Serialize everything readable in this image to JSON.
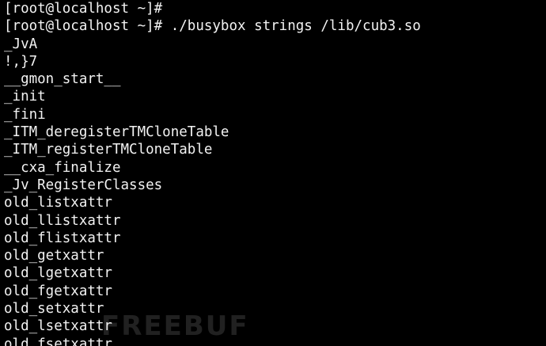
{
  "terminal": {
    "background": "#000000",
    "foreground": "#f2f2f2",
    "lines": [
      "[root@localhost ~]#",
      "[root@localhost ~]# ./busybox strings /lib/cub3.so",
      "_JvA",
      "!,}7",
      "__gmon_start__",
      "_init",
      "_fini",
      "_ITM_deregisterTMCloneTable",
      "_ITM_registerTMCloneTable",
      "__cxa_finalize",
      "_Jv_RegisterClasses",
      "old_listxattr",
      "old_llistxattr",
      "old_flistxattr",
      "old_getxattr",
      "old_lgetxattr",
      "old_fgetxattr",
      "old_setxattr",
      "old_lsetxattr",
      "old_fsetxattr"
    ]
  },
  "watermark": {
    "text": "FREEBUF"
  }
}
